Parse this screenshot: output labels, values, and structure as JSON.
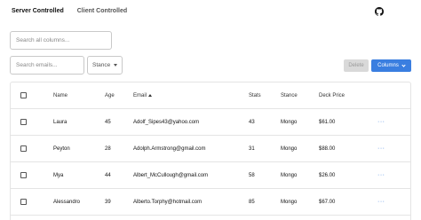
{
  "tabs": {
    "active": "Server Controlled",
    "other": "Client Controlled"
  },
  "search": {
    "all_placeholder": "Search all columns...",
    "email_placeholder": "Search emails..."
  },
  "filters": {
    "stance_label": "Stance"
  },
  "toolbar": {
    "delete_label": "Delete",
    "columns_label": "Columns"
  },
  "colors": {
    "accent": "#3a7ee0",
    "disabled": "#d9d9d9"
  },
  "table": {
    "headers": [
      "Name",
      "Age",
      "Email",
      "Stats",
      "Stance",
      "Deck Price"
    ],
    "rows": [
      {
        "name": "Laura",
        "age": "45",
        "email": "Adolf_Sipes43@yahoo.com",
        "stats": "43",
        "stance": "Mongo",
        "price": "$61.00"
      },
      {
        "name": "Peyton",
        "age": "28",
        "email": "Adolph.Armstrong@gmail.com",
        "stats": "31",
        "stance": "Mongo",
        "price": "$88.00"
      },
      {
        "name": "Mya",
        "age": "44",
        "email": "Albert_McCullough@gmail.com",
        "stats": "58",
        "stance": "Mongo",
        "price": "$26.00"
      },
      {
        "name": "Alessandro",
        "age": "39",
        "email": "Alberto.Torphy@hotmail.com",
        "stats": "85",
        "stance": "Mongo",
        "price": "$67.00"
      }
    ],
    "more_label": "···"
  }
}
